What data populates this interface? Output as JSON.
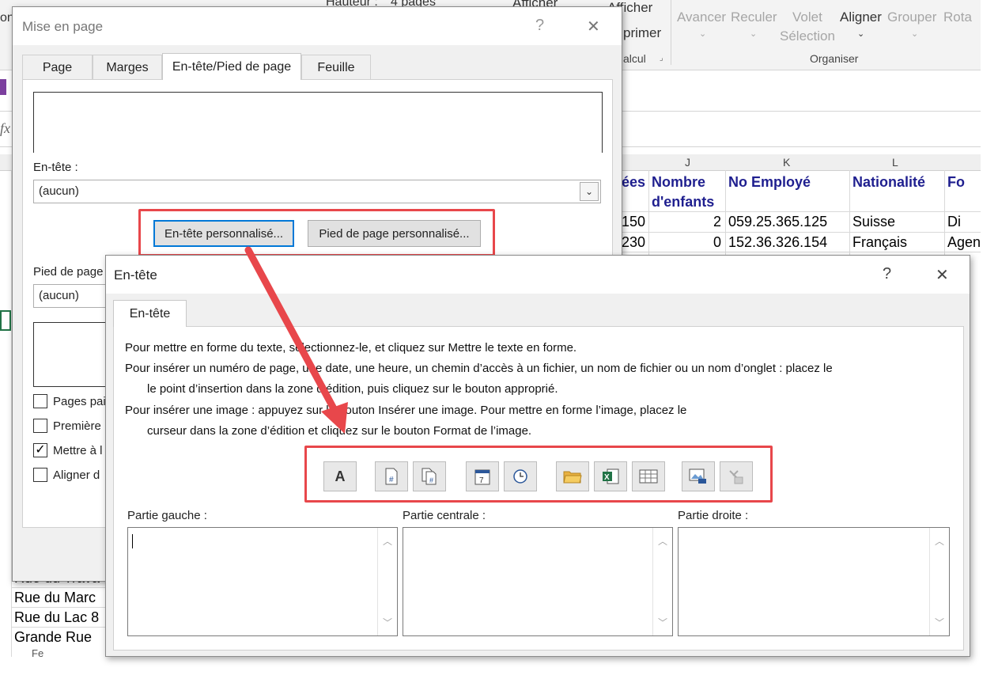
{
  "excel": {
    "ribbon": {
      "hauteur_label": "Hauteur :",
      "hauteur_value": "4 pages",
      "afficher1": "Afficher",
      "afficher2": "Afficher",
      "imprimer": "primer",
      "calcul": "alcul",
      "avancer": "Avancer",
      "reculer": "Reculer",
      "volet_line1": "Volet",
      "volet_line2": "Sélection",
      "aligner": "Aligner",
      "grouper": "Grouper",
      "rotation": "Rota",
      "organiser": "Organiser",
      "left_clip": "on"
    },
    "formula_fx": "fx",
    "columns": [
      "J",
      "K",
      "L"
    ],
    "headers": {
      "partial_col": "ées",
      "nombre_line1": "Nombre",
      "nombre_line2": "d'enfants",
      "no_employe": "No Employé",
      "nationalite": "Nationalité",
      "fo": "Fo"
    },
    "rows": [
      {
        "a": "150",
        "b": "2",
        "c": "059.25.365.125",
        "d": "Suisse",
        "e": "Di"
      },
      {
        "a": "230",
        "b": "0",
        "c": "152.36.326.154",
        "d": "Français",
        "e": "Agen"
      }
    ],
    "left_rows": [
      "Rue du Trava",
      "Rue du Marc",
      "Rue du Lac 8",
      "Grande Rue"
    ],
    "bottom_tab": "Fe"
  },
  "mise_en_page": {
    "title": "Mise en page",
    "help": "?",
    "close": "✕",
    "tabs": [
      {
        "label": "Page",
        "active": false
      },
      {
        "label": "Marges",
        "active": false
      },
      {
        "label": "En-tête/Pied de page",
        "active": true
      },
      {
        "label": "Feuille",
        "active": false
      }
    ],
    "entete_label": "En-tête :",
    "entete_value": "(aucun)",
    "btn_entete_perso": "En-tête personnalisé...",
    "btn_pied_perso": "Pied de page personnalisé...",
    "pied_label": "Pied de page",
    "pied_value": "(aucun)",
    "checkboxes": [
      {
        "label": "Pages pai",
        "checked": false
      },
      {
        "label": "Première",
        "checked": false
      },
      {
        "label": "Mettre à l",
        "checked": true
      },
      {
        "label": "Aligner d",
        "checked": false
      }
    ]
  },
  "entete_dialog": {
    "title": "En-tête",
    "help": "?",
    "close": "✕",
    "tab": "En-tête",
    "instructions": [
      "Pour mettre en forme du texte, sélectionnez-le, et cliquez sur Mettre le texte en forme.",
      "Pour insérer un numéro de page, une date, une heure, un chemin d’accès à un fichier, un nom de fichier ou un nom d’onglet : placez le",
      "le point d’insertion dans la zone d’édition, puis cliquez sur le bouton approprié.",
      "Pour insérer une image : appuyez sur le bouton Insérer une image. Pour mettre en forme l’image, placez le",
      "curseur dans la zone d’édition et cliquez sur le bouton Format de l’image."
    ],
    "tools": [
      {
        "name": "format-text-icon",
        "glyph": "A"
      },
      {
        "name": "page-number-icon",
        "glyph": "#"
      },
      {
        "name": "page-count-icon",
        "glyph": "#"
      },
      {
        "name": "date-icon",
        "glyph": "7"
      },
      {
        "name": "time-icon",
        "glyph": "clock"
      },
      {
        "name": "file-path-icon",
        "glyph": "folder"
      },
      {
        "name": "file-name-icon",
        "glyph": "excel"
      },
      {
        "name": "sheet-name-icon",
        "glyph": "grid"
      },
      {
        "name": "insert-image-icon",
        "glyph": "image"
      },
      {
        "name": "format-image-icon",
        "glyph": "paint"
      }
    ],
    "sections": [
      {
        "label": "Partie gauche :",
        "value": ""
      },
      {
        "label": "Partie centrale :",
        "value": ""
      },
      {
        "label": "Partie droite :",
        "value": ""
      }
    ]
  },
  "colors": {
    "highlight_red": "#e8474b",
    "header_blue": "#1f1f8f",
    "focus_blue": "#0078d7"
  }
}
